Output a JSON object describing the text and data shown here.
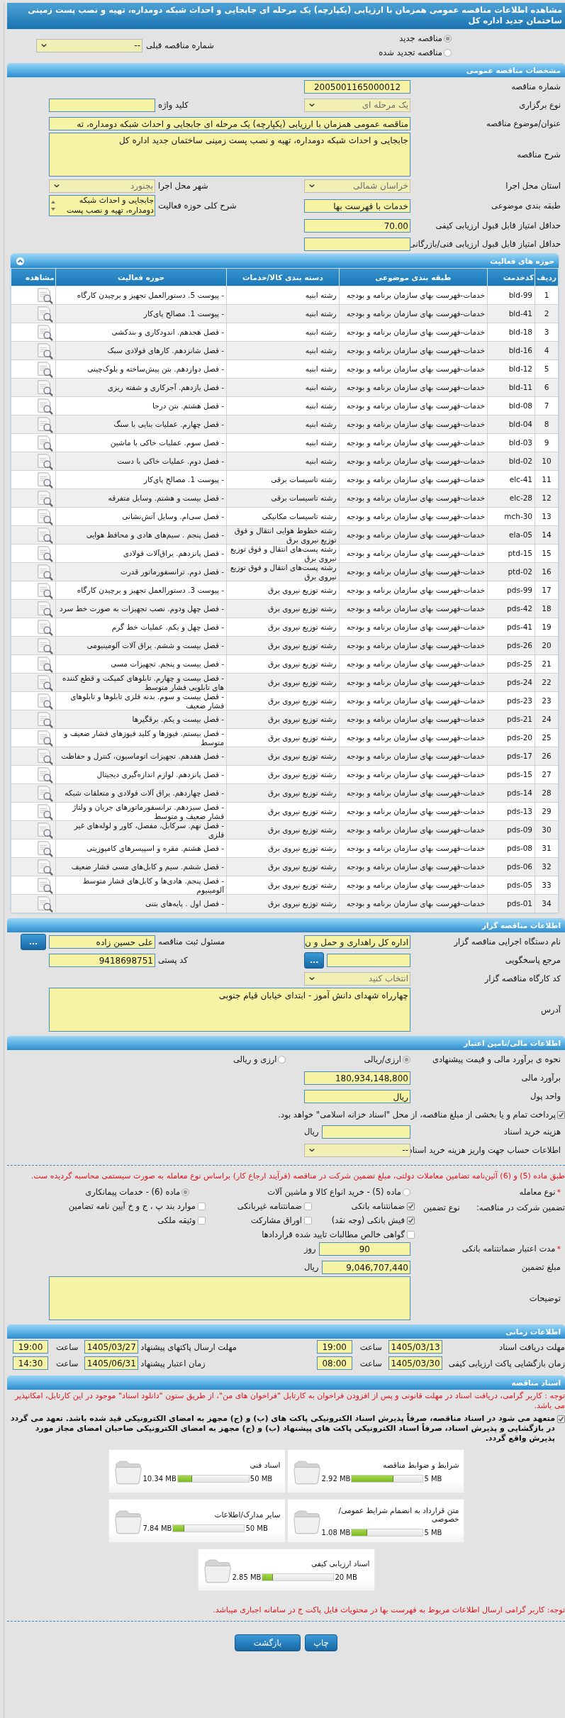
{
  "page_title": "مشاهده اطلاعات مناقصه عمومی همزمان با ارزیابی (یکپارچه) یک مرحله ای جابجایی و احداث شبکه دومداره، تهیه و نصب پست زمینی ساختمان جدید اداره کل",
  "tender_type": [
    {
      "label": "مناقصه جدید",
      "selected": true
    },
    {
      "label": "مناقصه تجدید شده",
      "selected": false
    }
  ],
  "previous_tender": {
    "label": "شماره مناقصه قبلی",
    "kind": "select",
    "value": "--",
    "disabled": false
  },
  "general": {
    "title": "مشخصات مناقصه عمومی",
    "rows": [
      [
        {
          "label": "شماره مناقصه",
          "kind": "input",
          "value": "2005001165000012",
          "center": true
        }
      ],
      [
        {
          "label": "نوع برگزاری",
          "kind": "select",
          "value": "یک مرحله ای",
          "disabled": true
        },
        {
          "label": "کلید واژه",
          "kind": "input"
        }
      ],
      [
        {
          "label": "عنوان/موضوع مناقصه",
          "kind": "long-input",
          "value": "مناقصه عمومی همزمان با ارزیابی (یکپارچه) یک مرحله ای جابجایی و احداث شبکه دومداره، ته"
        }
      ],
      [
        {
          "label": "شرح مناقصه",
          "kind": "textarea",
          "value": "جابجایی و احداث شبکه دومداره، تهیه و نصب پست زمینی ساختمان جدید اداره کل"
        }
      ],
      [
        {
          "label": "استان محل اجرا",
          "kind": "select",
          "value": "خراسان شمالی",
          "disabled": true
        },
        {
          "label": "شهر محل اجرا",
          "kind": "select",
          "value": "بجنورد",
          "disabled": true
        }
      ],
      [
        {
          "label": "طبقه بندی موضوعی",
          "kind": "input",
          "value": "خدمات با فهرست بها"
        },
        {
          "label": "شرح کلی حوزه فعالیت",
          "kind": "listbox",
          "value": "جابجایی و احداث شبکه دومداره، تهیه و نصب پست"
        }
      ],
      [
        {
          "label": "حداقل امتیاز قابل قبول ارزیابی کیفی",
          "kind": "input",
          "value": "70.00"
        }
      ],
      [
        {
          "label": "حداقل امتیاز قابل قبول ارزیابی فنی/بازرگانی",
          "kind": "input"
        }
      ]
    ]
  },
  "activities": {
    "title": "حوزه های فعالیت",
    "expanded": true,
    "columns": [
      "ردیف",
      "کدخدمت",
      "طبقه بندی موضوعی",
      "دسته بندی کالا/خدمات",
      "حوزه فعالیت",
      "مشاهده"
    ],
    "rows": [
      {
        "row": "1",
        "code": "bld-99",
        "category": "خدمات-فهرست بهای سازمان برنامه و بودجه",
        "group": "رشته ابنیه",
        "activity": "- پیوست 5. دستورالعمل تجهیز و برچیدن کارگاه"
      },
      {
        "row": "2",
        "code": "bld-41",
        "category": "خدمات-فهرست بهای سازمان برنامه و بودجه",
        "group": "رشته ابنیه",
        "activity": "- پیوست 1. مصالح پای‌کار"
      },
      {
        "row": "3",
        "code": "bld-18",
        "category": "خدمات-فهرست بهای سازمان برنامه و بودجه",
        "group": "رشته ابنیه",
        "activity": "- فصل هجدهم. اندودکاری و بندکشی"
      },
      {
        "row": "4",
        "code": "bld-16",
        "category": "خدمات-فهرست بهای سازمان برنامه و بودجه",
        "group": "رشته ابنیه",
        "activity": "- فصل شانزدهم. کارهای فولادی سبک"
      },
      {
        "row": "5",
        "code": "bld-12",
        "category": "خدمات-فهرست بهای سازمان برنامه و بودجه",
        "group": "رشته ابنیه",
        "activity": "- فصل دوازدهم. بتن پیش‌ساخته و بلوک‌چینی"
      },
      {
        "row": "6",
        "code": "bld-11",
        "category": "خدمات-فهرست بهای سازمان برنامه و بودجه",
        "group": "رشته ابنیه",
        "activity": "- فصل یازدهم. آجرکاری و شفته ریزی"
      },
      {
        "row": "7",
        "code": "bld-08",
        "category": "خدمات-فهرست بهای سازمان برنامه و بودجه",
        "group": "رشته ابنیه",
        "activity": "- فصل هشتم. بتن درجا"
      },
      {
        "row": "8",
        "code": "bld-04",
        "category": "خدمات-فهرست بهای سازمان برنامه و بودجه",
        "group": "رشته ابنیه",
        "activity": "- فصل چهارم. عملیات بنایی با سنگ"
      },
      {
        "row": "9",
        "code": "bld-03",
        "category": "خدمات-فهرست بهای سازمان برنامه و بودجه",
        "group": "رشته ابنیه",
        "activity": "- فصل سوم. عملیات خاکی با ماشین"
      },
      {
        "row": "10",
        "code": "bld-02",
        "category": "خدمات-فهرست بهای سازمان برنامه و بودجه",
        "group": "رشته ابنیه",
        "activity": "- فصل دوم. عملیات خاکی با دست"
      },
      {
        "row": "11",
        "code": "elc-41",
        "category": "خدمات-فهرست بهای سازمان برنامه و بودجه",
        "group": "رشته تاسیسات برقی",
        "activity": "- پیوست 1. مصالح پای‌کار"
      },
      {
        "row": "12",
        "code": "elc-28",
        "category": "خدمات-فهرست بهای سازمان برنامه و بودجه",
        "group": "رشته تاسیسات برقی",
        "activity": "- فصل بیست و هشتم. وسایل متفرقه"
      },
      {
        "row": "13",
        "code": "mch-30",
        "category": "خدمات-فهرست بهای سازمان برنامه و بودجه",
        "group": "رشته تاسیسات مکانیکی",
        "activity": "- فصل سی‌ام. وسایل آتش‌نشانی"
      },
      {
        "row": "14",
        "code": "ela-05",
        "category": "خدمات-فهرست بهای سازمان برنامه و بودجه",
        "group": "رشته خطوط هوایی انتقال و فوق توزیع نیروی برق",
        "activity": "- فصل پنجم . سیم‌های هادی و محافظ هوایی"
      },
      {
        "row": "15",
        "code": "ptd-15",
        "category": "خدمات-فهرست بهای سازمان برنامه و بودجه",
        "group": "رشته پست‌های انتقال و فوق توزیع نیروی برق",
        "activity": "- فصل پانزدهم. یراق‌آلات فولادی"
      },
      {
        "row": "16",
        "code": "ptd-02",
        "category": "خدمات-فهرست بهای سازمان برنامه و بودجه",
        "group": "رشته پست‌های انتقال و فوق توزیع نیروی برق",
        "activity": "- فصل دوم. ترانسفورماتور قدرت"
      },
      {
        "row": "17",
        "code": "pds-99",
        "category": "خدمات-فهرست بهای سازمان برنامه و بودجه",
        "group": "رشته توزیع نیروی برق",
        "activity": "- پیوست 3. دستورالعمل تجهیز و برچیدن کارگاه"
      },
      {
        "row": "18",
        "code": "pds-42",
        "category": "خدمات-فهرست بهای سازمان برنامه و بودجه",
        "group": "رشته توزیع نیروی برق",
        "activity": "- فصل چهل ودوم. نصب تجهیزات به صورت خط سرد"
      },
      {
        "row": "19",
        "code": "pds-41",
        "category": "خدمات-فهرست بهای سازمان برنامه و بودجه",
        "group": "رشته توزیع نیروی برق",
        "activity": "- فصل چهل و یکم. عملیات خط گرم"
      },
      {
        "row": "20",
        "code": "pds-26",
        "category": "خدمات-فهرست بهای سازمان برنامه و بودجه",
        "group": "رشته توزیع نیروی برق",
        "activity": "- فصل بیست و ششم. یراق آلات آلومینیومی"
      },
      {
        "row": "21",
        "code": "pds-25",
        "category": "خدمات-فهرست بهای سازمان برنامه و بودجه",
        "group": "رشته توزیع نیروی برق",
        "activity": "- فصل بیست و پنجم. تجهیزات مسی"
      },
      {
        "row": "22",
        "code": "pds-24",
        "category": "خدمات-فهرست بهای سازمان برنامه و بودجه",
        "group": "رشته توزیع نیروی برق",
        "activity": "- فصل بیست و چهارم. تابلوهای کمپکت و قطع کننده های تابلویی فشار متوسط"
      },
      {
        "row": "23",
        "code": "pds-23",
        "category": "خدمات-فهرست بهای سازمان برنامه و بودجه",
        "group": "رشته توزیع نیروی برق",
        "activity": "- فصل بیست و سوم. بدنه فلزی تابلوها و تابلوهای فشار ضعیف"
      },
      {
        "row": "24",
        "code": "pds-21",
        "category": "خدمات-فهرست بهای سازمان برنامه و بودجه",
        "group": "رشته توزیع نیروی برق",
        "activity": "- فصل بیست و یکم. برقگیرها"
      },
      {
        "row": "25",
        "code": "pds-20",
        "category": "خدمات-فهرست بهای سازمان برنامه و بودجه",
        "group": "رشته توزیع نیروی برق",
        "activity": "- فصل بیستم. فیوزها و کلید فیوزهای فشار ضعیف و متوسط"
      },
      {
        "row": "26",
        "code": "pds-17",
        "category": "خدمات-فهرست بهای سازمان برنامه و بودجه",
        "group": "رشته توزیع نیروی برق",
        "activity": "- فصل هفدهم. تجهیزات اتوماسیون، کنترل و حفاظت"
      },
      {
        "row": "27",
        "code": "pds-15",
        "category": "خدمات-فهرست بهای سازمان برنامه و بودجه",
        "group": "رشته توزیع نیروی برق",
        "activity": "- فصل پانزدهم. لوازم اندازه‌گیری دیجیتال"
      },
      {
        "row": "28",
        "code": "pds-14",
        "category": "خدمات-فهرست بهای سازمان برنامه و بودجه",
        "group": "رشته توزیع نیروی برق",
        "activity": "- فصل چهاردهم. یراق آلات فولادی و متعلقات شبکه"
      },
      {
        "row": "29",
        "code": "pds-13",
        "category": "خدمات-فهرست بهای سازمان برنامه و بودجه",
        "group": "رشته توزیع نیروی برق",
        "activity": "- فصل سیزدهم. ترانسفورماتورهای جریان و ولتاژ فشار ضعیف و متوسط"
      },
      {
        "row": "30",
        "code": "pds-09",
        "category": "خدمات-فهرست بهای سازمان برنامه و بودجه",
        "group": "رشته توزیع نیروی برق",
        "activity": "- فصل نهم. سرکابل، مفصل، کاور و لوله‌های غیر فلزی"
      },
      {
        "row": "31",
        "code": "pds-08",
        "category": "خدمات-فهرست بهای سازمان برنامه و بودجه",
        "group": "رشته توزیع نیروی برق",
        "activity": "- فصل هشتم. مقره و اسپیسرهای کامپوزیتی"
      },
      {
        "row": "32",
        "code": "pds-06",
        "category": "خدمات-فهرست بهای سازمان برنامه و بودجه",
        "group": "رشته توزیع نیروی برق",
        "activity": "- فصل ششم. سیم و کابل‌های مسی فشار ضعیف"
      },
      {
        "row": "33",
        "code": "pds-05",
        "category": "خدمات-فهرست بهای سازمان برنامه و بودجه",
        "group": "رشته توزیع نیروی برق",
        "activity": "- فصل پنجم. هادی‌ها و کابل‌های فشار متوسط آلومینیوم"
      },
      {
        "row": "34",
        "code": "pds-01",
        "category": "خدمات-فهرست بهای سازمان برنامه و بودجه",
        "group": "رشته توزیع نیروی برق",
        "activity": "- فصل اول . پایه‌های بتنی"
      }
    ]
  },
  "tenderer": {
    "title": "اطلاعات مناقصه گزار",
    "rows": [
      [
        {
          "label": "نام دستگاه اجرایی مناقصه گزار",
          "kind": "input",
          "value": "اداره کل راهداری و حمل و ن"
        },
        {
          "label": "مسئول ثبت مناقصه",
          "kind": "input",
          "value": "علی حسین زاده",
          "button": "..."
        }
      ],
      [
        {
          "label": "مرجع پاسخگویی",
          "kind": "input",
          "button": "..."
        },
        {
          "label": "کد پستی",
          "kind": "input",
          "value": "9418698751"
        }
      ],
      [
        {
          "label": "کد کارگاه مناقصه گزار",
          "kind": "select",
          "value": "انتخاب کنید",
          "disabled": true
        }
      ],
      [
        {
          "label": "آدرس",
          "kind": "textarea",
          "value": "چهارراه شهدای دانش آموز - ابتدای خیابان قیام جنوبی"
        }
      ]
    ]
  },
  "finance": {
    "title": "اطلاعات مالی/تامین اعتبار",
    "estimate_method": {
      "label": "نحوه ی برآورد مالی و قیمت پیشنهادی",
      "options": [
        {
          "label": "ارزی/ریالی",
          "selected": true
        },
        {
          "label": "ارزی و ریالی",
          "selected": false
        }
      ]
    },
    "rows": [
      [
        {
          "label": "برآورد مالی",
          "kind": "input",
          "value": "180,934,148,800"
        }
      ],
      [
        {
          "label": "واحد پول",
          "kind": "input",
          "value": "ریال"
        }
      ]
    ],
    "treasury": {
      "label": "پرداخت تمام و یا بخشی از مبلغ مناقصه، از محل \"اسناد خزانه اسلامی\" خواهد بود.",
      "checked": true
    },
    "rows2": [
      [
        {
          "label": "هزینه خرید اسناد",
          "kind": "input",
          "unit": "ریال"
        }
      ],
      [
        {
          "label": "اطلاعات حساب جهت واریز هزینه خرید اسناد",
          "kind": "select",
          "value": "--",
          "disabled": false
        }
      ]
    ],
    "note": "طبق ماده (5) و (6) آئین‌نامه تضامین معاملات دولتی، مبلغ تضمین شرکت در مناقصه (فرآیند ارجاع کار) براساس نوع معامله به صورت سیستمی محاسبه گردیده ست.",
    "deal_type": {
      "mark": "*",
      "label": "نوع معامله",
      "options": [
        {
          "label": "ماده (5) - خرید انواع کالا و ماشین آلات",
          "selected": false
        },
        {
          "label": "ماده (6) - خدمات پیمانکاری",
          "selected": true
        }
      ]
    },
    "guarantee": {
      "label": "تضمین شرکت در مناقصه:",
      "type_label": "نوع تضمین",
      "options": [
        {
          "label": "ضمانتنامه بانکی",
          "checked": true
        },
        {
          "label": "ضمانتنامه غیربانکی",
          "checked": false
        },
        {
          "label": "موارد بند پ ، ج و خ آیین نامه تضامین",
          "checked": false
        },
        {
          "label": "فیش بانکی (وجه نقد)",
          "checked": true
        },
        {
          "label": "اوراق مشارکت",
          "checked": false
        },
        {
          "label": "وثیقه ملکی",
          "checked": false
        },
        {
          "label": "گواهی خالص مطالبات تایید شده قراردادها",
          "checked": false
        }
      ]
    },
    "rows3": [
      [
        {
          "mark": "*",
          "label": "مدت اعتبار ضمانتنامه بانکی",
          "kind": "input",
          "value": "90",
          "unit": "روز",
          "center": true
        }
      ],
      [
        {
          "label": "مبلغ تضمین",
          "kind": "input",
          "value": "9,046,707,440",
          "unit": "ریال"
        }
      ],
      [
        {
          "label": "توضیحات",
          "kind": "textarea"
        }
      ]
    ]
  },
  "schedule": {
    "title": "اطلاعات زمانی",
    "rows": [
      [
        {
          "label": "مهلت دریافت اسناد",
          "date": "1405/03/13",
          "time_label": "ساعت",
          "time": "19:00"
        },
        {
          "label": "مهلت ارسال پاکتهای پیشنهاد",
          "date": "1405/03/27",
          "time_label": "ساعت",
          "time": "19:00"
        }
      ],
      [
        {
          "label": "زمان بازگشایی پاکت ارزیابی کیفی",
          "date": "1405/03/30",
          "time_label": "ساعت",
          "time": "08:00"
        },
        {
          "label": "زمان اعتبار پیشنهاد",
          "date": "1405/06/31",
          "time_label": "ساعت",
          "time": "14:30"
        }
      ]
    ]
  },
  "documents": {
    "title": "اسناد مناقصه",
    "note": "توجه : کاربر گرامی، دریافت اسناد در مهلت قانونی و پس از افزودن فراخوان به کارتابل \"فراخوان های من\"، از طریق ستون \"دانلود اسناد\" موجود در این کارتابل، امکانپذیر می باشد.",
    "commitment": {
      "label": "متعهد می شود در اسناد مناقصه، صرفاً پذیرش اسناد الکترونیکی پاکت های (ب) و (ج) مجهز به امضای الکترونیکی قید شده باشد. تعهد می گردد در بازگشایی و پذیرش اسناد، صرفاً اسناد الکترونیکی پاکت های پیشنهاد (ب) و (ج) مجهز به امضای الکترونیکی صاحبان امضای مجاز مورد پذیرش واقع گردد.",
      "checked": true
    },
    "files": [
      {
        "title": "شرایط و ضوابط مناقصه",
        "size": "2.92 MB",
        "limit": "5 MB",
        "level": 0.584
      },
      {
        "title": "اسناد فنی",
        "size": "10.34 MB",
        "limit": "50 MB",
        "level": 0.207
      },
      {
        "title": "متن قرارداد به انضمام شرایط عمومی/خصوصی",
        "size": "1.08 MB",
        "limit": "5 MB",
        "level": 0.216
      },
      {
        "title": "سایر مدارک/اطلاعات",
        "size": "7.84 MB",
        "limit": "50 MB",
        "level": 0.157
      },
      {
        "title": "اسناد ارزیابی کیفی",
        "size": "2.85 MB",
        "limit": "20 MB",
        "level": 0.143
      }
    ],
    "footer_note": "توجه: کاربر گرامی ارسال اطلاعات مربوط به فهرست بها در محتویات فایل پاکت ج در سامانه اجباری میباشد."
  },
  "buttons": [
    "چاپ",
    "بازگشت"
  ]
}
